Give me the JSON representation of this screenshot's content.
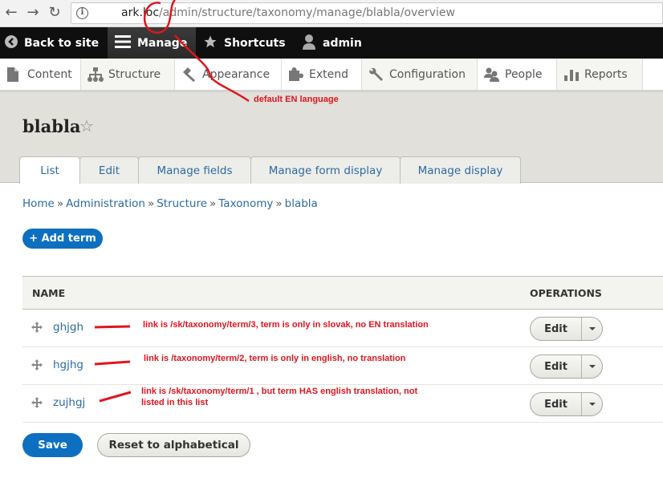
{
  "browser": {
    "url_host": "ark.loc",
    "url_path": "/admin/structure/taxonomy/manage/blabla/overview",
    "back_icon": "arrow-left-icon",
    "forward_icon": "arrow-right-icon",
    "reload_icon": "reload-icon",
    "info_icon": "info-icon"
  },
  "toolbar": {
    "back_to_site": "Back to site",
    "manage": "Manage",
    "shortcuts": "Shortcuts",
    "user": "admin"
  },
  "tray": {
    "items": [
      {
        "label": "Content",
        "icon": "file-icon"
      },
      {
        "label": "Structure",
        "icon": "sitemap-icon"
      },
      {
        "label": "Appearance",
        "icon": "brush-icon"
      },
      {
        "label": "Extend",
        "icon": "puzzle-icon"
      },
      {
        "label": "Configuration",
        "icon": "wrench-icon"
      },
      {
        "label": "People",
        "icon": "people-icon"
      },
      {
        "label": "Reports",
        "icon": "bar-chart-icon"
      }
    ]
  },
  "page": {
    "title": "blabla",
    "tabs": [
      {
        "label": "List",
        "active": true
      },
      {
        "label": "Edit",
        "active": false
      },
      {
        "label": "Manage fields",
        "active": false
      },
      {
        "label": "Manage form display",
        "active": false
      },
      {
        "label": "Manage display",
        "active": false
      }
    ],
    "breadcrumb": [
      "Home",
      "Administration",
      "Structure",
      "Taxonomy",
      "blabla"
    ],
    "breadcrumb_separator": "»",
    "add_term": "+ Add term"
  },
  "table": {
    "headers": {
      "name": "NAME",
      "operations": "OPERATIONS"
    },
    "rows": [
      {
        "name": "ghjgh",
        "op_label": "Edit"
      },
      {
        "name": "hgjhg",
        "op_label": "Edit"
      },
      {
        "name": "zujhgj",
        "op_label": "Edit"
      }
    ]
  },
  "actions": {
    "save": "Save",
    "reset": "Reset to alphabetical"
  },
  "annotations": {
    "language": "default EN language",
    "row1": "link is /sk/taxonomy/term/3, term is only in slovak, no EN translation",
    "row2": "link is /taxonomy/term/2, term is only in english, no translation",
    "row3_line1": "link is /sk/taxonomy/term/1 , but term HAS english translation, not",
    "row3_line2": "listed in this list",
    "color": "#e0151d"
  },
  "colors": {
    "link": "#2b6ba3",
    "primary_button": "#0d6fc0",
    "toolbar_bg": "#0f0f0f",
    "header_bg": "#e1e0db"
  }
}
